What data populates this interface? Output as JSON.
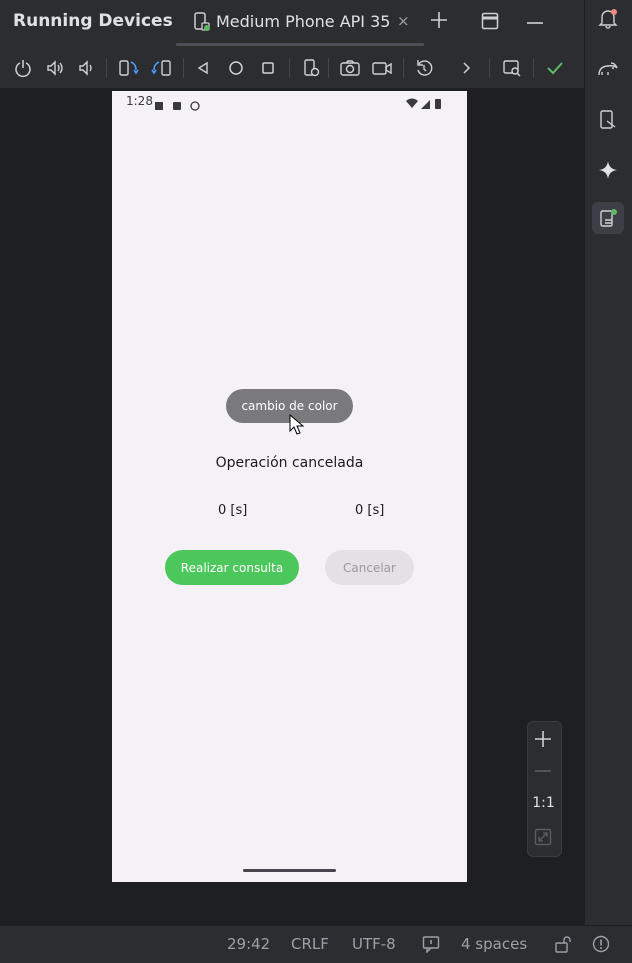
{
  "window": {
    "title": "Running Devices"
  },
  "tab": {
    "label": "Medium Phone API 35",
    "close": "×"
  },
  "toolbar": {
    "icons": [
      "power-icon",
      "volume-up-icon",
      "volume-down-icon",
      "rotate-left-icon",
      "rotate-right-icon",
      "back-icon",
      "home-icon",
      "overview-icon",
      "device-settings-icon",
      "screenshot-icon",
      "screen-record-icon",
      "reset-icon",
      "more-icon",
      "snapshot-icon",
      "check-icon"
    ]
  },
  "phone": {
    "status_time": "1:28",
    "center_button": "cambio de color",
    "operation_text": "Operación cancelada",
    "time_left": "0 [s]",
    "time_right": "0 [s]",
    "consult_button": "Realizar consulta",
    "cancel_button": "Cancelar"
  },
  "zoom": {
    "ratio_label": "1:1"
  },
  "statusbar": {
    "position": "29:42",
    "line_ending": "CRLF",
    "encoding": "UTF-8",
    "indent": "4 spaces"
  },
  "colors": {
    "accent_green": "#4cc75b",
    "check_green": "#5fb865",
    "ide_background": "#2b2d30",
    "device_background": "#1e1f22"
  }
}
